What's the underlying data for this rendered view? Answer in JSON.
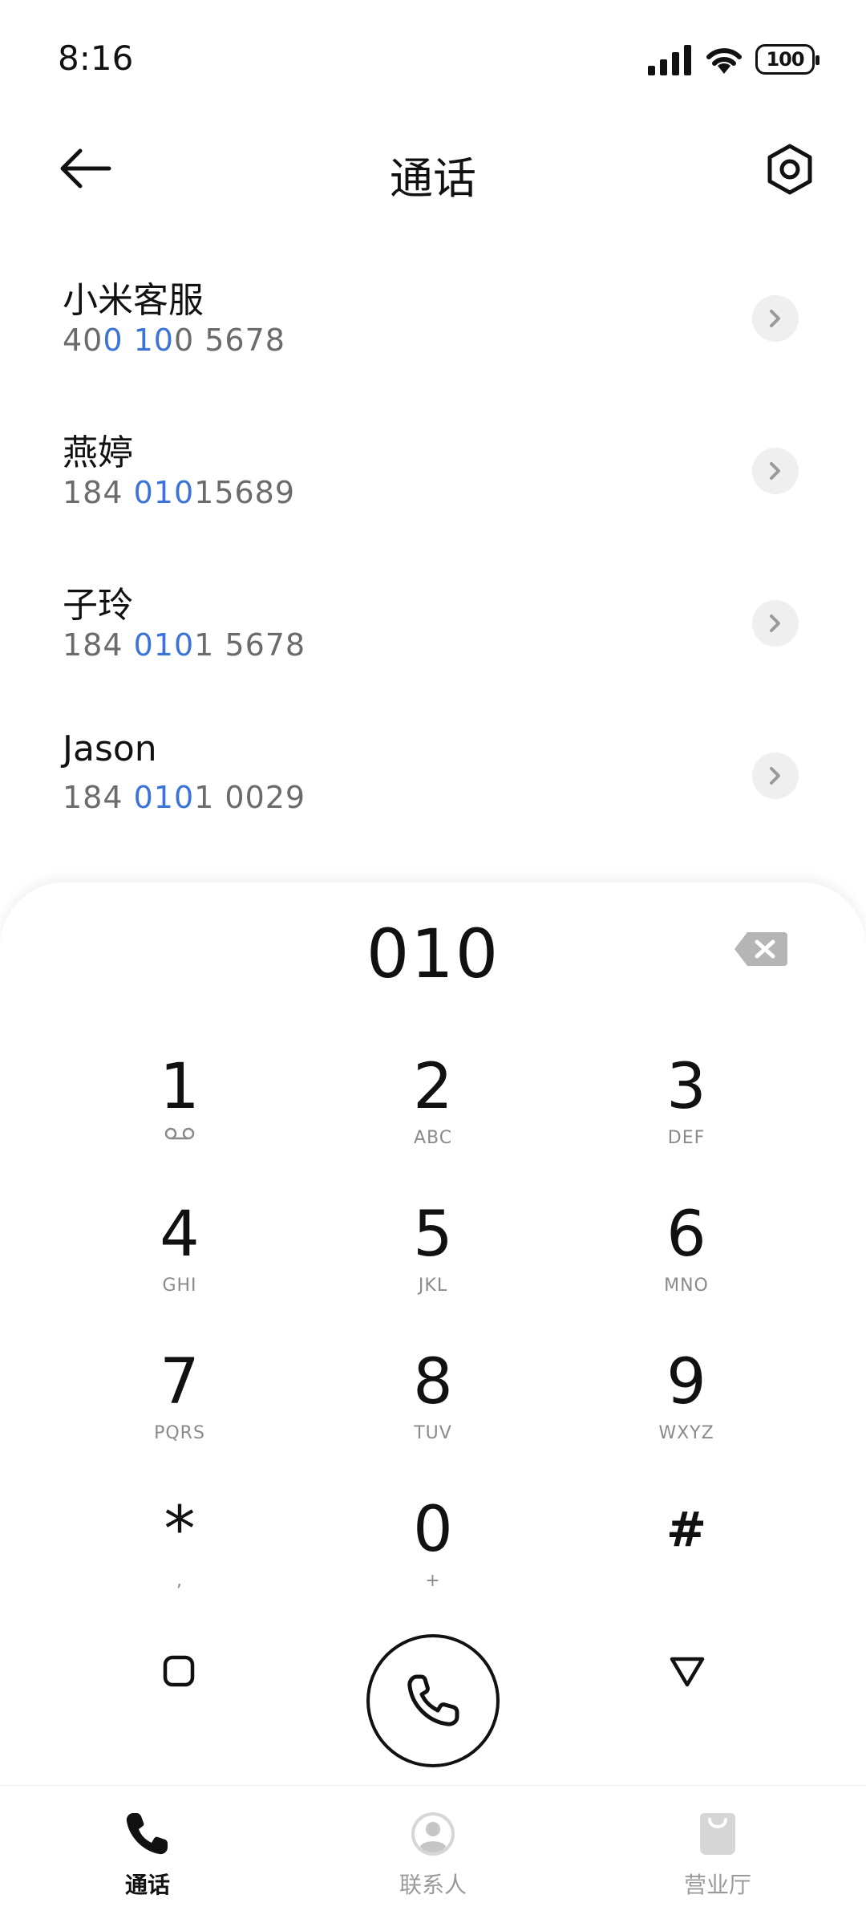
{
  "status_bar": {
    "time": "8:16",
    "battery": "100"
  },
  "header": {
    "title": "通话"
  },
  "contacts": [
    {
      "name": "小米客服",
      "number_parts": [
        "40",
        "0 10",
        "0 5678"
      ]
    },
    {
      "name": "燕婷",
      "number_parts": [
        "184 ",
        "010",
        "15689"
      ]
    },
    {
      "name": "子玲",
      "number_parts": [
        "184 ",
        "010",
        "1 5678"
      ]
    },
    {
      "name": "Jason",
      "number_parts": [
        "184 ",
        "010",
        "1 0029"
      ]
    }
  ],
  "colors": {
    "highlight": "#3a74d8",
    "text": "#111111",
    "secondary": "#6b6b6b"
  },
  "dialpad": {
    "number": "010",
    "keys": [
      {
        "digit": "1",
        "letters": ""
      },
      {
        "digit": "2",
        "letters": "ABC"
      },
      {
        "digit": "3",
        "letters": "DEF"
      },
      {
        "digit": "4",
        "letters": "GHI"
      },
      {
        "digit": "5",
        "letters": "JKL"
      },
      {
        "digit": "6",
        "letters": "MNO"
      },
      {
        "digit": "7",
        "letters": "PQRS"
      },
      {
        "digit": "8",
        "letters": "TUV"
      },
      {
        "digit": "9",
        "letters": "WXYZ"
      },
      {
        "digit": "*",
        "letters": ","
      },
      {
        "digit": "0",
        "letters": "+"
      },
      {
        "digit": "#",
        "letters": ""
      }
    ]
  },
  "bottom_nav": {
    "items": [
      {
        "label": "通话",
        "icon": "phone-icon",
        "active": true
      },
      {
        "label": "联系人",
        "icon": "person-icon",
        "active": false
      },
      {
        "label": "营业厅",
        "icon": "shopping-bag-icon",
        "active": false
      }
    ]
  }
}
